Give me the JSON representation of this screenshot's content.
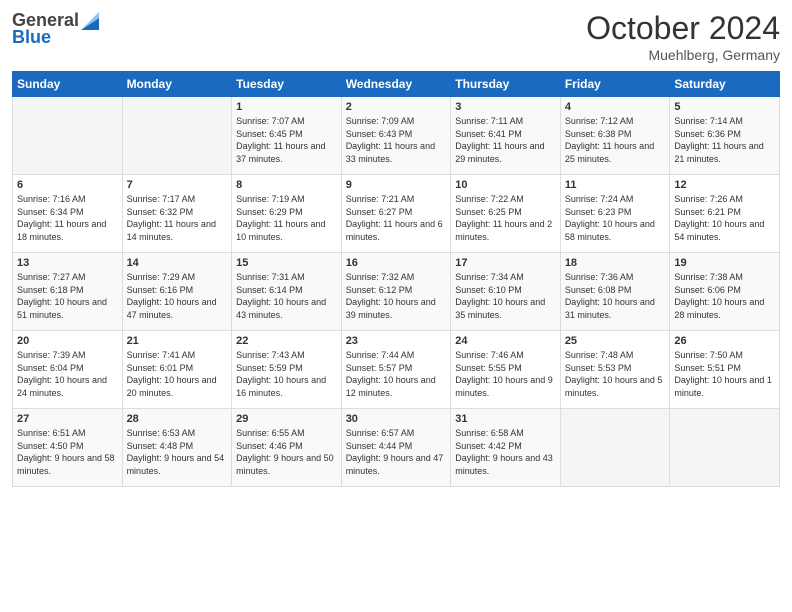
{
  "logo": {
    "general": "General",
    "blue": "Blue"
  },
  "header": {
    "month_year": "October 2024",
    "location": "Muehlberg, Germany"
  },
  "days_of_week": [
    "Sunday",
    "Monday",
    "Tuesday",
    "Wednesday",
    "Thursday",
    "Friday",
    "Saturday"
  ],
  "weeks": [
    [
      {
        "day": "",
        "sunrise": "",
        "sunset": "",
        "daylight": ""
      },
      {
        "day": "",
        "sunrise": "",
        "sunset": "",
        "daylight": ""
      },
      {
        "day": "1",
        "sunrise": "Sunrise: 7:07 AM",
        "sunset": "Sunset: 6:45 PM",
        "daylight": "Daylight: 11 hours and 37 minutes."
      },
      {
        "day": "2",
        "sunrise": "Sunrise: 7:09 AM",
        "sunset": "Sunset: 6:43 PM",
        "daylight": "Daylight: 11 hours and 33 minutes."
      },
      {
        "day": "3",
        "sunrise": "Sunrise: 7:11 AM",
        "sunset": "Sunset: 6:41 PM",
        "daylight": "Daylight: 11 hours and 29 minutes."
      },
      {
        "day": "4",
        "sunrise": "Sunrise: 7:12 AM",
        "sunset": "Sunset: 6:38 PM",
        "daylight": "Daylight: 11 hours and 25 minutes."
      },
      {
        "day": "5",
        "sunrise": "Sunrise: 7:14 AM",
        "sunset": "Sunset: 6:36 PM",
        "daylight": "Daylight: 11 hours and 21 minutes."
      }
    ],
    [
      {
        "day": "6",
        "sunrise": "Sunrise: 7:16 AM",
        "sunset": "Sunset: 6:34 PM",
        "daylight": "Daylight: 11 hours and 18 minutes."
      },
      {
        "day": "7",
        "sunrise": "Sunrise: 7:17 AM",
        "sunset": "Sunset: 6:32 PM",
        "daylight": "Daylight: 11 hours and 14 minutes."
      },
      {
        "day": "8",
        "sunrise": "Sunrise: 7:19 AM",
        "sunset": "Sunset: 6:29 PM",
        "daylight": "Daylight: 11 hours and 10 minutes."
      },
      {
        "day": "9",
        "sunrise": "Sunrise: 7:21 AM",
        "sunset": "Sunset: 6:27 PM",
        "daylight": "Daylight: 11 hours and 6 minutes."
      },
      {
        "day": "10",
        "sunrise": "Sunrise: 7:22 AM",
        "sunset": "Sunset: 6:25 PM",
        "daylight": "Daylight: 11 hours and 2 minutes."
      },
      {
        "day": "11",
        "sunrise": "Sunrise: 7:24 AM",
        "sunset": "Sunset: 6:23 PM",
        "daylight": "Daylight: 10 hours and 58 minutes."
      },
      {
        "day": "12",
        "sunrise": "Sunrise: 7:26 AM",
        "sunset": "Sunset: 6:21 PM",
        "daylight": "Daylight: 10 hours and 54 minutes."
      }
    ],
    [
      {
        "day": "13",
        "sunrise": "Sunrise: 7:27 AM",
        "sunset": "Sunset: 6:18 PM",
        "daylight": "Daylight: 10 hours and 51 minutes."
      },
      {
        "day": "14",
        "sunrise": "Sunrise: 7:29 AM",
        "sunset": "Sunset: 6:16 PM",
        "daylight": "Daylight: 10 hours and 47 minutes."
      },
      {
        "day": "15",
        "sunrise": "Sunrise: 7:31 AM",
        "sunset": "Sunset: 6:14 PM",
        "daylight": "Daylight: 10 hours and 43 minutes."
      },
      {
        "day": "16",
        "sunrise": "Sunrise: 7:32 AM",
        "sunset": "Sunset: 6:12 PM",
        "daylight": "Daylight: 10 hours and 39 minutes."
      },
      {
        "day": "17",
        "sunrise": "Sunrise: 7:34 AM",
        "sunset": "Sunset: 6:10 PM",
        "daylight": "Daylight: 10 hours and 35 minutes."
      },
      {
        "day": "18",
        "sunrise": "Sunrise: 7:36 AM",
        "sunset": "Sunset: 6:08 PM",
        "daylight": "Daylight: 10 hours and 31 minutes."
      },
      {
        "day": "19",
        "sunrise": "Sunrise: 7:38 AM",
        "sunset": "Sunset: 6:06 PM",
        "daylight": "Daylight: 10 hours and 28 minutes."
      }
    ],
    [
      {
        "day": "20",
        "sunrise": "Sunrise: 7:39 AM",
        "sunset": "Sunset: 6:04 PM",
        "daylight": "Daylight: 10 hours and 24 minutes."
      },
      {
        "day": "21",
        "sunrise": "Sunrise: 7:41 AM",
        "sunset": "Sunset: 6:01 PM",
        "daylight": "Daylight: 10 hours and 20 minutes."
      },
      {
        "day": "22",
        "sunrise": "Sunrise: 7:43 AM",
        "sunset": "Sunset: 5:59 PM",
        "daylight": "Daylight: 10 hours and 16 minutes."
      },
      {
        "day": "23",
        "sunrise": "Sunrise: 7:44 AM",
        "sunset": "Sunset: 5:57 PM",
        "daylight": "Daylight: 10 hours and 12 minutes."
      },
      {
        "day": "24",
        "sunrise": "Sunrise: 7:46 AM",
        "sunset": "Sunset: 5:55 PM",
        "daylight": "Daylight: 10 hours and 9 minutes."
      },
      {
        "day": "25",
        "sunrise": "Sunrise: 7:48 AM",
        "sunset": "Sunset: 5:53 PM",
        "daylight": "Daylight: 10 hours and 5 minutes."
      },
      {
        "day": "26",
        "sunrise": "Sunrise: 7:50 AM",
        "sunset": "Sunset: 5:51 PM",
        "daylight": "Daylight: 10 hours and 1 minute."
      }
    ],
    [
      {
        "day": "27",
        "sunrise": "Sunrise: 6:51 AM",
        "sunset": "Sunset: 4:50 PM",
        "daylight": "Daylight: 9 hours and 58 minutes."
      },
      {
        "day": "28",
        "sunrise": "Sunrise: 6:53 AM",
        "sunset": "Sunset: 4:48 PM",
        "daylight": "Daylight: 9 hours and 54 minutes."
      },
      {
        "day": "29",
        "sunrise": "Sunrise: 6:55 AM",
        "sunset": "Sunset: 4:46 PM",
        "daylight": "Daylight: 9 hours and 50 minutes."
      },
      {
        "day": "30",
        "sunrise": "Sunrise: 6:57 AM",
        "sunset": "Sunset: 4:44 PM",
        "daylight": "Daylight: 9 hours and 47 minutes."
      },
      {
        "day": "31",
        "sunrise": "Sunrise: 6:58 AM",
        "sunset": "Sunset: 4:42 PM",
        "daylight": "Daylight: 9 hours and 43 minutes."
      },
      {
        "day": "",
        "sunrise": "",
        "sunset": "",
        "daylight": ""
      },
      {
        "day": "",
        "sunrise": "",
        "sunset": "",
        "daylight": ""
      }
    ]
  ]
}
